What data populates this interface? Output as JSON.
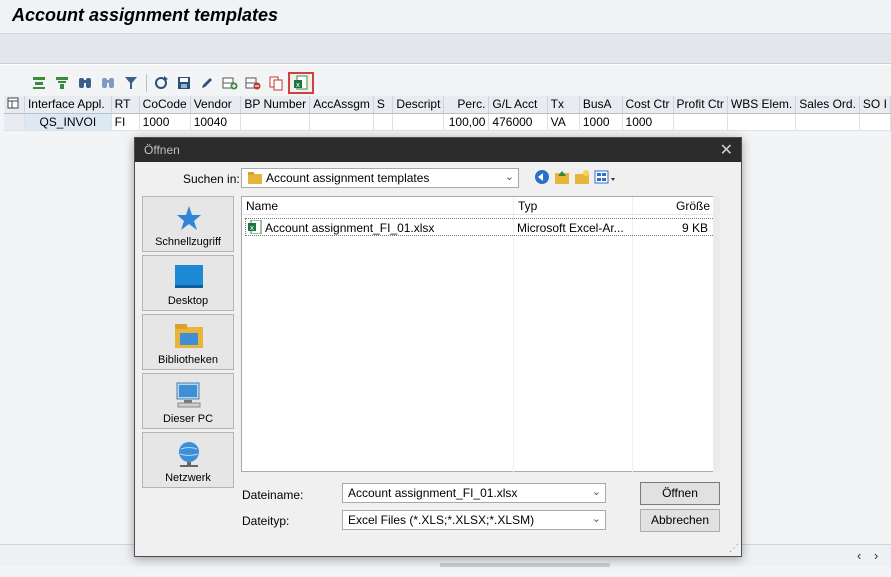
{
  "app": {
    "title": "Account assignment templates"
  },
  "toolbar": {
    "buttons": [
      "details-icon",
      "select-icon",
      "find-icon",
      "find-next-icon",
      "filter-icon",
      "refresh-icon",
      "save-icon",
      "edit-icon",
      "insert-row-icon",
      "delete-row-icon",
      "copy-icon",
      "excel-import-icon"
    ],
    "highlight_color": "#d04040"
  },
  "grid": {
    "columns": [
      "Interface Appl.",
      "RT",
      "CoCode",
      "Vendor",
      "BP Number",
      "AccAssgm",
      "S",
      "Descript",
      "Perc.",
      "G/L Acct",
      "Tx",
      "BusA",
      "Cost Ctr",
      "Profit Ctr",
      "WBS Elem.",
      "Sales Ord.",
      "SO I"
    ],
    "rows": [
      [
        "QS_INVOI",
        "FI",
        "1000",
        "10040",
        "",
        "",
        "",
        "",
        "100,00",
        "476000",
        "VA",
        "1000",
        "1000",
        "",
        "",
        "",
        ""
      ]
    ]
  },
  "dialog": {
    "title": "Öffnen",
    "close": "✕",
    "look_in_label": "Suchen in:",
    "look_in_value": "Account assignment templates",
    "places": [
      {
        "label": "Schnellzugriff",
        "icon": "star-icon"
      },
      {
        "label": "Desktop",
        "icon": "desktop-icon"
      },
      {
        "label": "Bibliotheken",
        "icon": "libraries-icon"
      },
      {
        "label": "Dieser PC",
        "icon": "computer-icon"
      },
      {
        "label": "Netzwerk",
        "icon": "network-icon"
      }
    ],
    "list_headers": {
      "name": "Name",
      "type": "Typ",
      "size": "Größe"
    },
    "files": [
      {
        "name": "Account assignment_FI_01.xlsx",
        "type": "Microsoft Excel-Ar...",
        "size": "9 KB"
      }
    ],
    "filename_label": "Dateiname:",
    "filename_value": "Account assignment_FI_01.xlsx",
    "filetype_label": "Dateityp:",
    "filetype_value": "Excel Files (*.XLS;*.XLSX;*.XLSM)",
    "open_button": "Öffnen",
    "cancel_button": "Abbrechen"
  },
  "scroll": {
    "left_arrow": "‹",
    "right_arrow": "›"
  }
}
